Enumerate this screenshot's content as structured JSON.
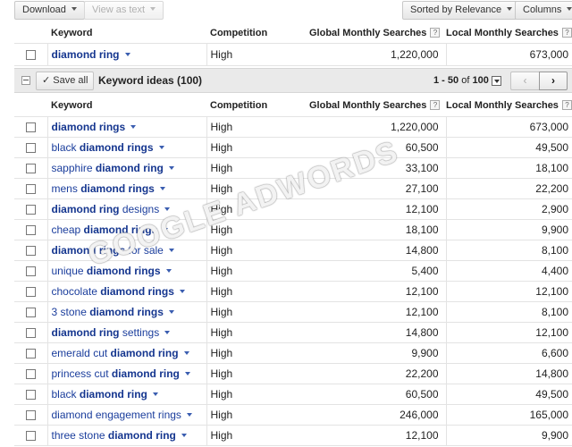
{
  "toolbar": {
    "download_label": "Download",
    "view_as_text_label": "View as text",
    "sorted_label": "Sorted by Relevance",
    "columns_label": "Columns"
  },
  "columns": {
    "keyword": "Keyword",
    "competition": "Competition",
    "global": "Global Monthly Searches",
    "local": "Local Monthly Searches",
    "help_mark": "?"
  },
  "search_term": {
    "keyword": "diamond ring",
    "competition": "High",
    "global": "1,220,000",
    "local": "673,000"
  },
  "ideas_bar": {
    "save_all_label": "Save all",
    "title": "Keyword ideas (100)",
    "pager_range": "1 - 50",
    "pager_of": "of",
    "pager_total": "100",
    "prev_glyph": "‹",
    "next_glyph": "›"
  },
  "watermark": "GOOGLE ADWORDS",
  "ideas": [
    {
      "pre": "",
      "bold": "diamond rings",
      "post": "",
      "competition": "High",
      "global": "1,220,000",
      "local": "673,000"
    },
    {
      "pre": "black ",
      "bold": "diamond rings",
      "post": "",
      "competition": "High",
      "global": "60,500",
      "local": "49,500"
    },
    {
      "pre": "sapphire ",
      "bold": "diamond ring",
      "post": "",
      "competition": "High",
      "global": "33,100",
      "local": "18,100"
    },
    {
      "pre": "mens ",
      "bold": "diamond rings",
      "post": "",
      "competition": "High",
      "global": "27,100",
      "local": "22,200"
    },
    {
      "pre": "",
      "bold": "diamond ring",
      "post": " designs",
      "competition": "High",
      "global": "12,100",
      "local": "2,900"
    },
    {
      "pre": "cheap ",
      "bold": "diamond rings",
      "post": "",
      "competition": "High",
      "global": "18,100",
      "local": "9,900"
    },
    {
      "pre": "",
      "bold": "diamond rings",
      "post": " for sale",
      "competition": "High",
      "global": "14,800",
      "local": "8,100"
    },
    {
      "pre": "unique ",
      "bold": "diamond rings",
      "post": "",
      "competition": "High",
      "global": "5,400",
      "local": "4,400"
    },
    {
      "pre": "chocolate ",
      "bold": "diamond rings",
      "post": "",
      "competition": "High",
      "global": "12,100",
      "local": "12,100"
    },
    {
      "pre": "3 stone ",
      "bold": "diamond rings",
      "post": "",
      "competition": "High",
      "global": "12,100",
      "local": "8,100"
    },
    {
      "pre": "",
      "bold": "diamond ring",
      "post": " settings",
      "competition": "High",
      "global": "14,800",
      "local": "12,100"
    },
    {
      "pre": "emerald cut ",
      "bold": "diamond ring",
      "post": "",
      "competition": "High",
      "global": "9,900",
      "local": "6,600"
    },
    {
      "pre": "princess cut ",
      "bold": "diamond ring",
      "post": "",
      "competition": "High",
      "global": "22,200",
      "local": "14,800"
    },
    {
      "pre": "black ",
      "bold": "diamond ring",
      "post": "",
      "competition": "High",
      "global": "60,500",
      "local": "49,500"
    },
    {
      "pre": "diamond engagement rings",
      "bold": "",
      "post": "",
      "competition": "High",
      "global": "246,000",
      "local": "165,000"
    },
    {
      "pre": "three stone ",
      "bold": "diamond ring",
      "post": "",
      "competition": "High",
      "global": "12,100",
      "local": "9,900"
    }
  ]
}
